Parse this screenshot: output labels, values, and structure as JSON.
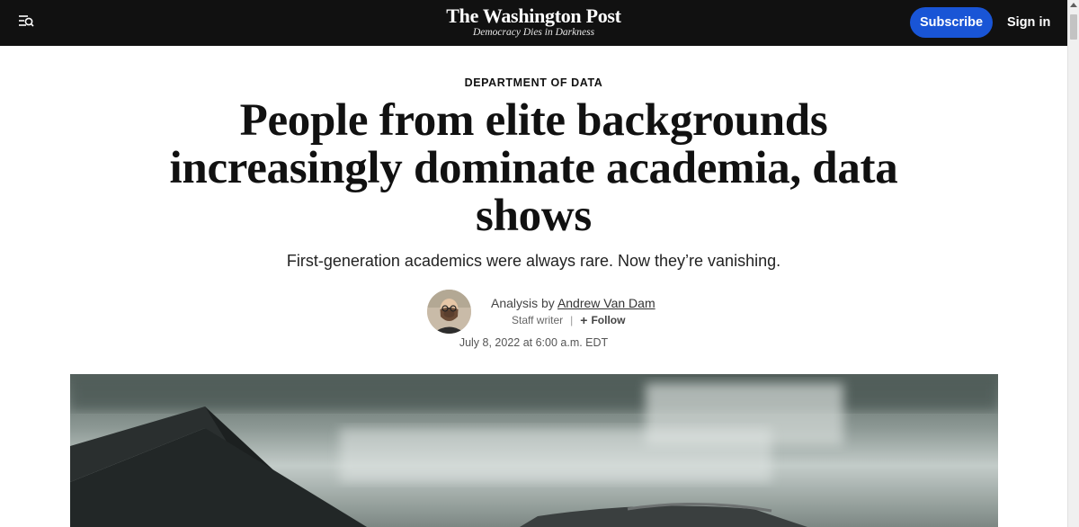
{
  "header": {
    "logo": "The Washington Post",
    "tagline": "Democracy Dies in Darkness",
    "subscribe_label": "Subscribe",
    "signin_label": "Sign in",
    "menu_icon": "menu-search-icon"
  },
  "article": {
    "kicker": "DEPARTMENT OF DATA",
    "headline": "People from elite backgrounds increasingly dominate academia, data shows",
    "dek": "First-generation academics were always rare. Now they’re vanishing.",
    "byline": {
      "prefix": "Analysis by",
      "author": "Andrew Van Dam",
      "role": "Staff writer",
      "follow_label": "Follow"
    },
    "dateline": "July 8, 2022 at 6:00 a.m. EDT",
    "hero_image": "graduation-cap-photo"
  },
  "colors": {
    "topbar_bg": "#111111",
    "subscribe_bg": "#1955d6",
    "text": "#111111"
  }
}
